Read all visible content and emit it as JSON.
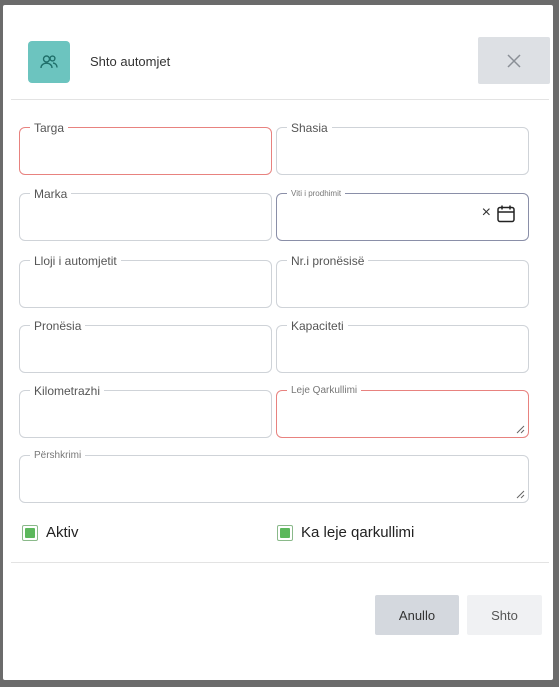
{
  "header": {
    "title": "Shto automjet",
    "icon": "users-icon",
    "close_icon": "close-icon",
    "accent_color": "#6cc4bf"
  },
  "fields": {
    "targa": {
      "label": "Targa",
      "value": ""
    },
    "shasia": {
      "label": "Shasia",
      "value": ""
    },
    "marka": {
      "label": "Marka",
      "value": ""
    },
    "viti": {
      "label": "Viti i prodhimit",
      "value": ""
    },
    "lloji": {
      "label": "Lloji i automjetit",
      "value": ""
    },
    "nr_pronesise": {
      "label": "Nr.i pronësisë",
      "value": ""
    },
    "pronesia": {
      "label": "Pronësia",
      "value": ""
    },
    "kapaciteti": {
      "label": "Kapaciteti",
      "value": ""
    },
    "kilometrazhi": {
      "label": "Kilometrazhi",
      "value": ""
    },
    "leje": {
      "label": "Leje Qarkullimi",
      "value": ""
    },
    "pershkrimi": {
      "label": "Përshkrimi",
      "value": ""
    }
  },
  "checkboxes": {
    "aktiv": {
      "label": "Aktiv",
      "checked": true
    },
    "ka_leje": {
      "label": "Ka leje qarkullimi",
      "checked": true
    }
  },
  "footer": {
    "cancel_label": "Anullo",
    "submit_label": "Shto"
  }
}
